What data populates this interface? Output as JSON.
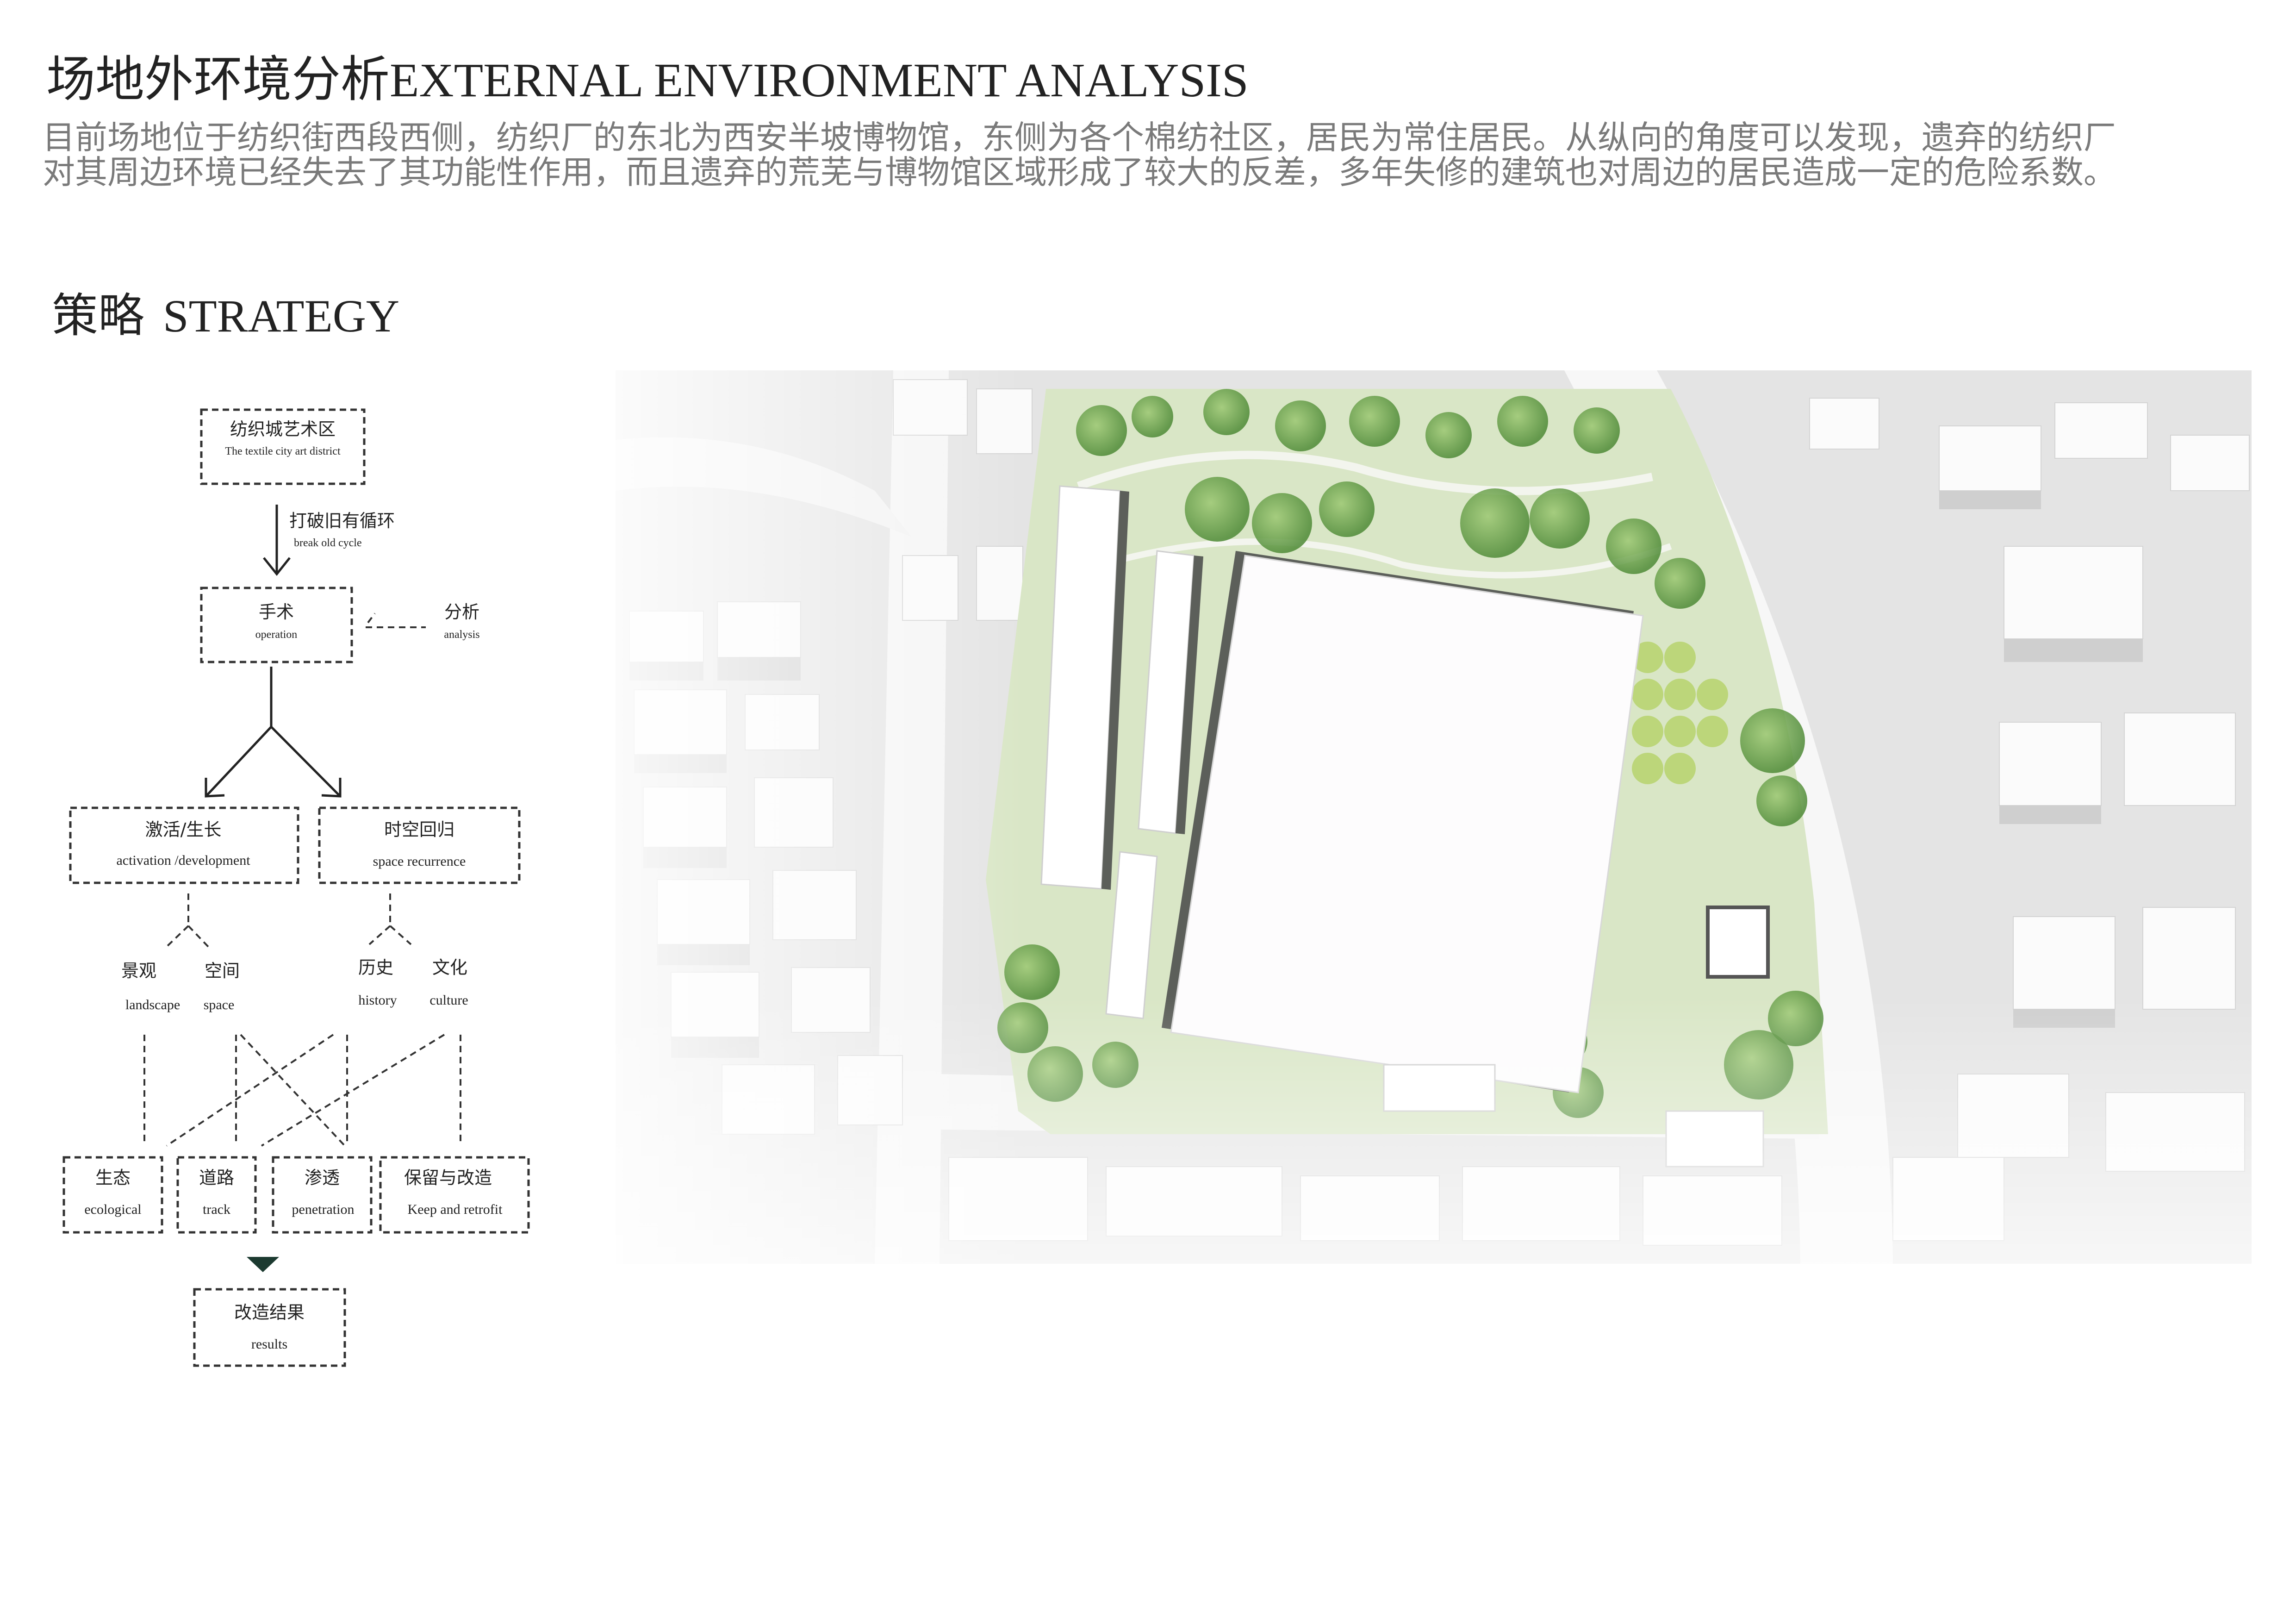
{
  "header": {
    "title_zh": "场地外环境分析",
    "title_en": "EXTERNAL ENVIRONMENT ANALYSIS",
    "description_line1": "目前场地位于纺织街西段西侧，纺织厂的东北为西安半坡博物馆，东侧为各个棉纺社区，居民为常住居民。从纵向的角度可以发现，遗弃的纺织厂",
    "description_line2": "对其周边环境已经失去了其功能性作用，而且遗弃的荒芜与博物馆区域形成了较大的反差，多年失修的建筑也对周边的居民造成一定的危险系数。"
  },
  "strategy": {
    "title_zh": "策略",
    "title_en": "STRATEGY"
  },
  "flowchart": {
    "district": {
      "zh": "纺织城艺术区",
      "en": "The textile city art district"
    },
    "break_cycle": {
      "zh": "打破旧有循环",
      "en": "break old cycle"
    },
    "operation": {
      "zh": "手术",
      "en": "operation"
    },
    "analysis": {
      "zh": "分析",
      "en": "analysis"
    },
    "activation": {
      "zh": "激活/生长",
      "en": "activation /development"
    },
    "recurrence": {
      "zh": "时空回归",
      "en": "space recurrence"
    },
    "landscape": {
      "zh": "景观",
      "en": "landscape"
    },
    "space": {
      "zh": "空间",
      "en": "space"
    },
    "history": {
      "zh": "历史",
      "en": "history"
    },
    "culture": {
      "zh": "文化",
      "en": "culture"
    },
    "ecological": {
      "zh": "生态",
      "en": "ecological"
    },
    "track": {
      "zh": "道路",
      "en": "track"
    },
    "penetration": {
      "zh": "渗透",
      "en": "penetration"
    },
    "retrofit": {
      "zh": "保留与改造",
      "en": "Keep and retrofit"
    },
    "results": {
      "zh": "改造结果",
      "en": "results"
    }
  },
  "colors": {
    "green_dark": "#4e8a36",
    "green_mid": "#7fae5a",
    "green_light": "#cfe0b3",
    "building_shadow": "#5c5f5a",
    "ground": "#e9e9e9"
  }
}
